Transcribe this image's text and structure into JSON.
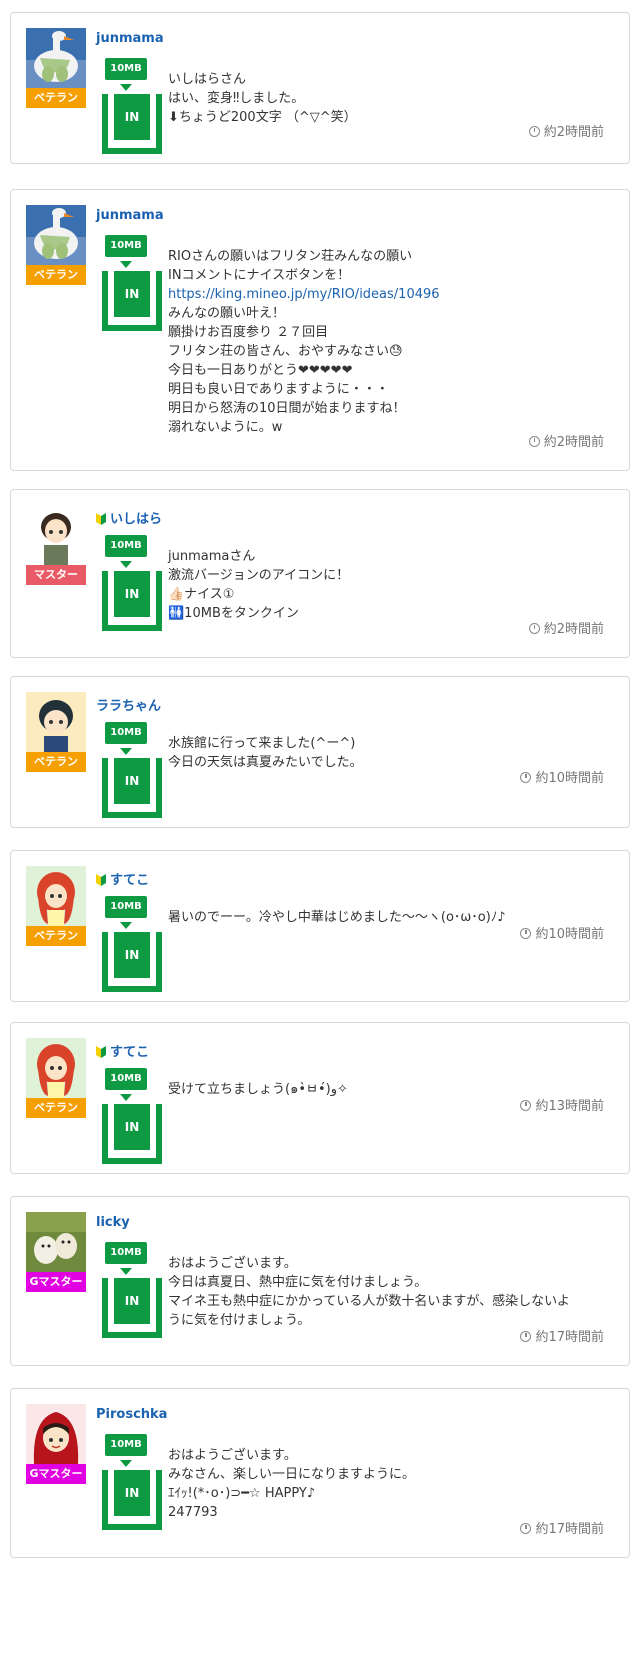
{
  "colors": {
    "veteran": "#f5a000",
    "master": "#e85b66",
    "gmaster": "#e100e1",
    "tank_green": "#0d9a43",
    "link_blue": "#1b62b0"
  },
  "posts": [
    {
      "user": "junmama",
      "badge": "ベテラン",
      "mb": "10MB",
      "in_label": "IN",
      "lines": [
        "いしはらさん",
        "はい、変身‼しました。",
        "⬇ちょうど200文字 （^▽^笑）"
      ],
      "time": "約2時間前"
    },
    {
      "user": "junmama",
      "badge": "ベテラン",
      "mb": "10MB",
      "in_label": "IN",
      "lines": [
        "RIOさんの願いはフリタン荘みんなの願い",
        "INコメントにナイスボタンを！",
        "https://king.mineo.jp/my/RIO/ideas/10496",
        "みんなの願い叶え！",
        "願掛けお百度参り ２７回目",
        "フリタン荘の皆さん、おやすみなさい😓",
        "今日も一日ありがとう❤❤❤❤❤",
        "明日も良い日でありますように・・・",
        "明日から怒涛の10日間が始まりますね！",
        "溺れないように。w"
      ],
      "time": "約2時間前"
    },
    {
      "user": "いしはら",
      "badge": "マスター",
      "mb": "10MB",
      "in_label": "IN",
      "lines": [
        "junmamaさん",
        "激流バージョンのアイコンに！",
        "👍🏻ナイス①",
        "🚻10MBをタンクイン"
      ],
      "time": "約2時間前"
    },
    {
      "user": "ララちゃん",
      "badge": "ベテラン",
      "mb": "10MB",
      "in_label": "IN",
      "lines": [
        "水族館に行って来ました(^ー^)",
        "今日の天気は真夏みたいでした。"
      ],
      "time": "約10時間前"
    },
    {
      "user": "すてこ",
      "badge": "ベテラン",
      "mb": "10MB",
      "in_label": "IN",
      "lines": [
        "暑いのでーー。冷やし中華はじめました〜〜ヽ(o･ω･o)ﾉ♪"
      ],
      "time": "約10時間前"
    },
    {
      "user": "すてこ",
      "badge": "ベテラン",
      "mb": "10MB",
      "in_label": "IN",
      "lines": [
        "受けて立ちましょう(๑•̀ㅂ•́)و✧"
      ],
      "time": "約13時間前"
    },
    {
      "user": "licky",
      "badge": "Gマスター",
      "mb": "10MB",
      "in_label": "IN",
      "lines": [
        "おはようございます。",
        "今日は真夏日、熱中症に気を付けましょう。",
        "マイネ王も熱中症にかかっている人が数十名いますが、感染しないよ",
        "うに気を付けましょう。"
      ],
      "time": "約17時間前"
    },
    {
      "user": "Piroschka",
      "badge": "Gマスター",
      "mb": "10MB",
      "in_label": "IN",
      "lines": [
        "おはようございます。",
        "みなさん、楽しい一日になりますように。",
        "ｴｲｯ!(*･o･)⊃━☆ HAPPY♪",
        "247793"
      ],
      "time": "約17時間前"
    }
  ]
}
